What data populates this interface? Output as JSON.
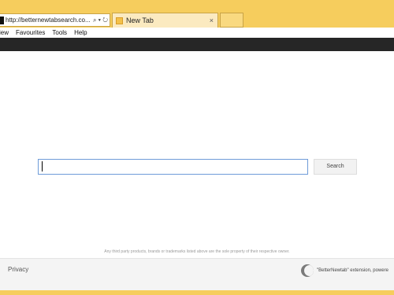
{
  "browser": {
    "address_url": "http://betternewtabsearch.co...",
    "address_icons": "⌕ ▾ ↻",
    "tab_title": "New Tab",
    "tab_close": "×"
  },
  "menu": {
    "items": [
      "iew",
      "Favourites",
      "Tools",
      "Help"
    ]
  },
  "search": {
    "placeholder": "",
    "button_label": "Search"
  },
  "page": {
    "disclaimer": "Any third party products, brands or trademarks listed above are the sole property of their respective owner."
  },
  "footer": {
    "privacy_label": "Privacy",
    "credit_text": "\"BetterNewtab\" extension, powere"
  },
  "colors": {
    "frame": "#f6cd5d",
    "dark_bar": "#262626",
    "input_border": "#6e9bd8"
  }
}
